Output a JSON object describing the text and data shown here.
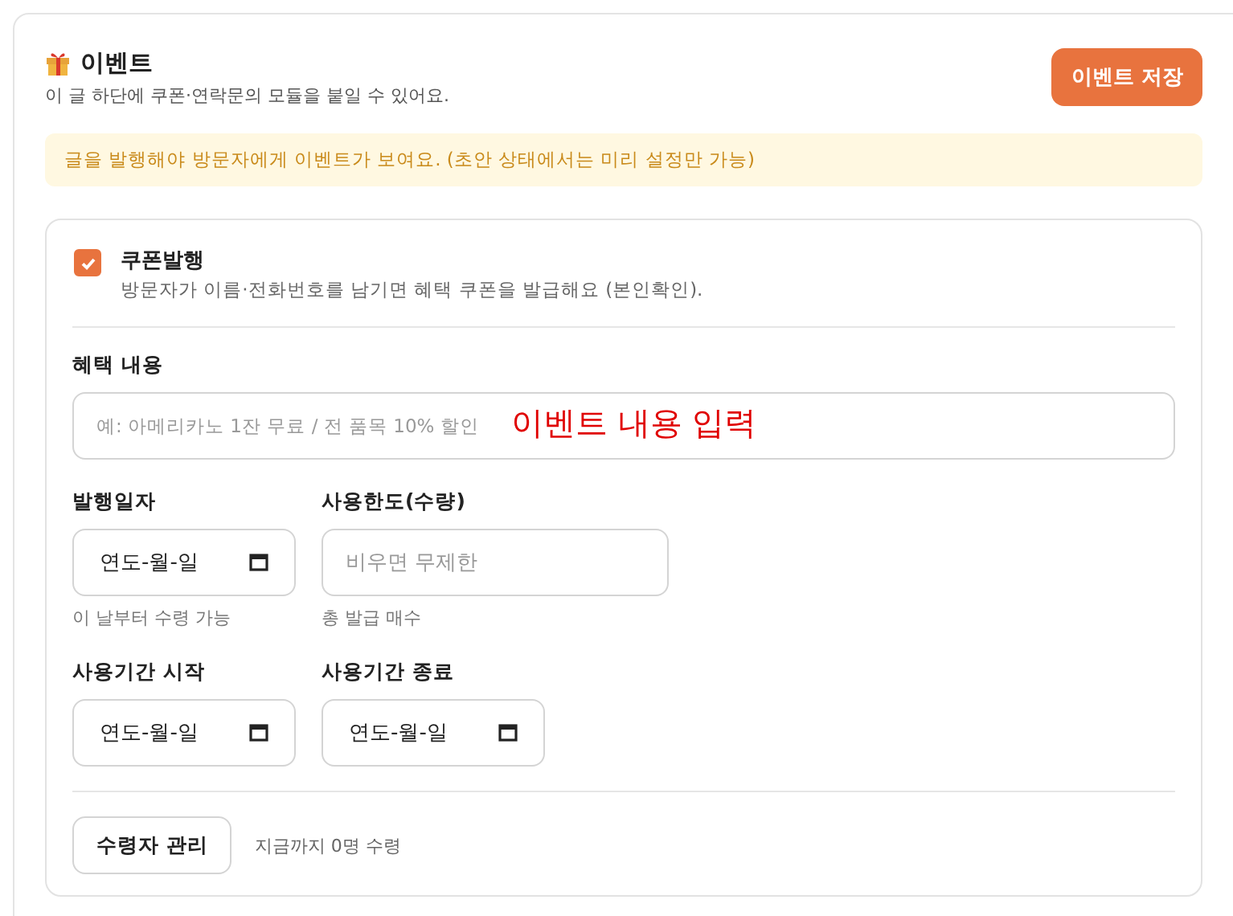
{
  "header": {
    "title": "이벤트",
    "subtitle": "이 글 하단에 쿠폰·연락문의 모듈을 붙일 수 있어요.",
    "save_button": "이벤트 저장"
  },
  "notice": "글을 발행해야 방문자에게 이벤트가 보여요. (초안 상태에서는 미리 설정만 가능)",
  "coupon": {
    "checked": true,
    "label": "쿠폰발행",
    "description": "방문자가 이름·전화번호를 남기면 혜택 쿠폰을 발급해요 (본인확인)."
  },
  "benefit": {
    "label": "혜택 내용",
    "placeholder": "예: 아메리카노 1잔 무료 / 전 품목 10% 할인",
    "annotation": "이벤트 내용 입력"
  },
  "fields": [
    {
      "kind": "date",
      "label": "발행일자",
      "value": "연도-월-일",
      "hint": "이 날부터 수령 가능"
    },
    {
      "kind": "text",
      "label": "사용한도(수량)",
      "placeholder": "비우면 무제한",
      "hint": "총 발급 매수"
    },
    {
      "kind": "date",
      "label": "사용기간 시작",
      "value": "연도-월-일"
    },
    {
      "kind": "date",
      "label": "사용기간 종료",
      "value": "연도-월-일"
    }
  ],
  "recipients": {
    "button": "수령자 관리",
    "count_text": "지금까지 0명 수령"
  }
}
